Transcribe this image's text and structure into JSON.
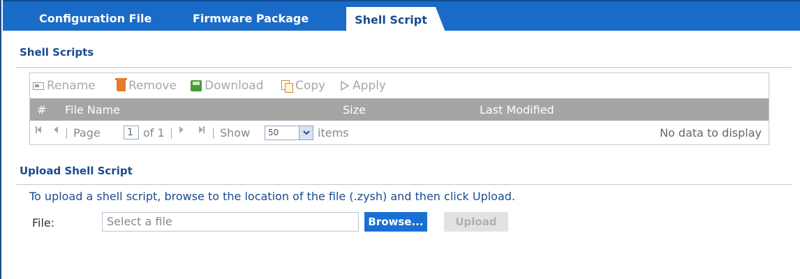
{
  "tabs": [
    {
      "label": "Configuration File",
      "active": false
    },
    {
      "label": "Firmware Package",
      "active": false
    },
    {
      "label": "Shell Script",
      "active": true
    }
  ],
  "shell_scripts": {
    "title": "Shell Scripts",
    "toolbar": {
      "rename": "Rename",
      "remove": "Remove",
      "download": "Download",
      "copy": "Copy",
      "apply": "Apply"
    },
    "columns": {
      "hash": "#",
      "file_name": "File Name",
      "size": "Size",
      "last_modified": "Last Modified"
    },
    "pager": {
      "page_label": "Page",
      "page_value": "1",
      "of_label": "of 1",
      "show_label": "Show",
      "show_value": "50",
      "items_label": "items",
      "no_data": "No data to display"
    }
  },
  "upload": {
    "title": "Upload Shell Script",
    "description": "To upload a shell script, browse to the location of the file (.zysh) and then click Upload.",
    "file_label": "File:",
    "file_placeholder": "Select a file",
    "browse_label": "Browse...",
    "upload_label": "Upload"
  },
  "colors": {
    "tabbar": "#1a6bc7",
    "accent_text": "#1a4c8c",
    "table_header": "#a5a5a5",
    "browse_button": "#1a6fd4",
    "remove_icon": "#e67a2e",
    "download_icon": "#4a9a3a"
  }
}
